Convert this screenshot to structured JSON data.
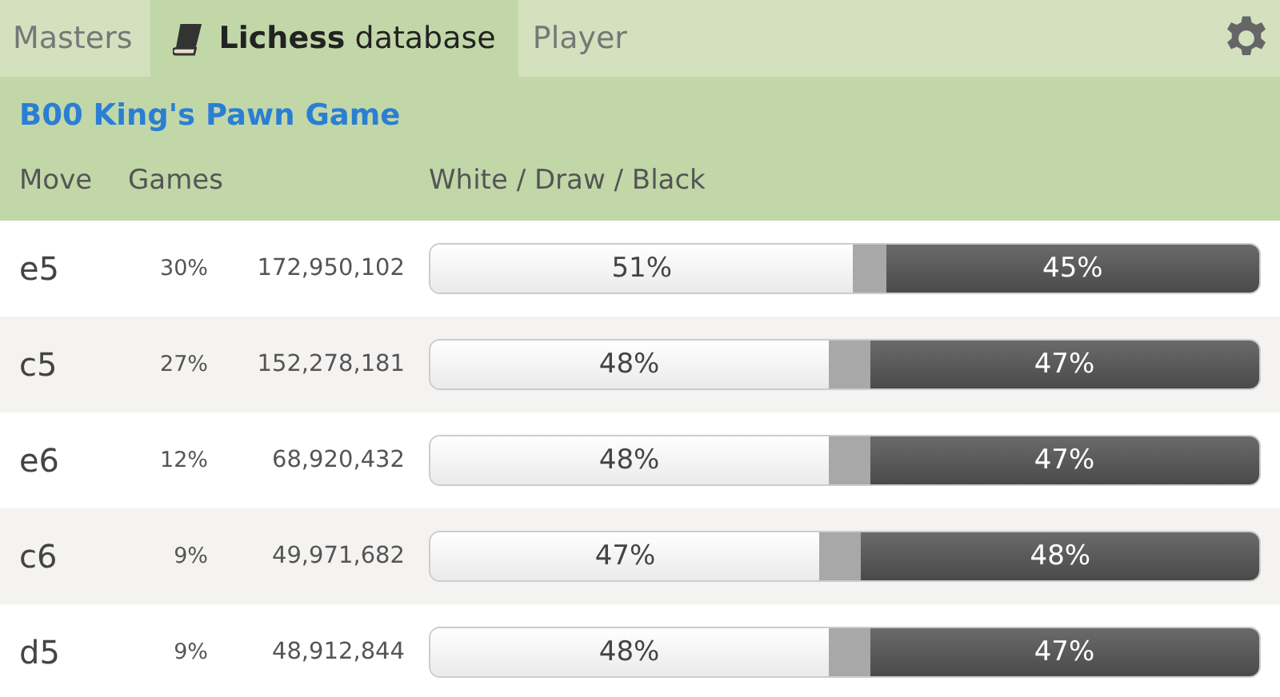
{
  "tabs": [
    {
      "label": "Masters",
      "selected": false
    },
    {
      "label": "**Lichess** database",
      "selected": true
    },
    {
      "label": "Player",
      "selected": false
    }
  ],
  "opening": {
    "title": "B00 King's Pawn Game"
  },
  "columns": [
    "Move",
    "Games",
    "White / Draw / Black"
  ],
  "rows": [
    {
      "move": "e5",
      "share": "30%",
      "games": "172,950,102",
      "white": "51%",
      "black": "45%"
    },
    {
      "move": "c5",
      "share": "27%",
      "games": "152,278,181",
      "white": "48%",
      "black": "47%"
    },
    {
      "move": "e6",
      "share": "12%",
      "games": "68,920,432",
      "white": "48%",
      "black": "47%"
    },
    {
      "move": "c6",
      "share": "9%",
      "games": "49,971,682",
      "white": "47%",
      "black": "48%"
    },
    {
      "move": "d5",
      "share": "9%",
      "games": "48,912,844",
      "white": "48%",
      "black": "47%"
    }
  ]
}
